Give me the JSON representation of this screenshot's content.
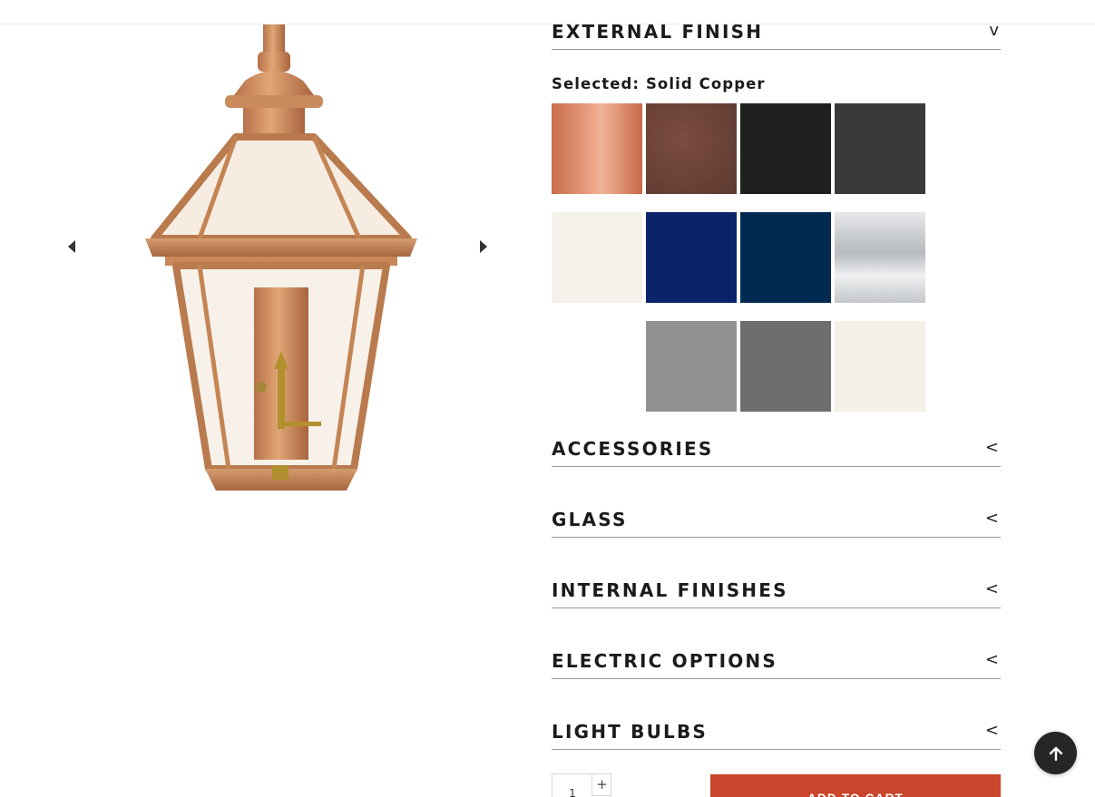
{
  "external_finish": {
    "title": "EXTERNAL FINISH",
    "toggle": "v",
    "selected_prefix": "Selected:",
    "selected_value": "Solid Copper",
    "swatches": [
      {
        "name": "swatch-solid-copper",
        "color": "#d97d58"
      },
      {
        "name": "swatch-antique-copper",
        "color": "#6a4337"
      },
      {
        "name": "swatch-black",
        "color": "#1f1f1f"
      },
      {
        "name": "swatch-charcoal",
        "color": "#3a3a3a"
      },
      {
        "name": "swatch-white",
        "color": "#f4f1ea"
      },
      {
        "name": "swatch-navy",
        "color": "#0a236a"
      },
      {
        "name": "swatch-dark-blue",
        "color": "#012a52"
      },
      {
        "name": "swatch-silver",
        "color": "#c9cbce"
      },
      {
        "name": "swatch-gray",
        "color": "#909290"
      },
      {
        "name": "swatch-dark-gray",
        "color": "#6e6e6e"
      },
      {
        "name": "swatch-cream",
        "color": "#f4f0e6"
      }
    ]
  },
  "sections": [
    {
      "title": "ACCESSORIES",
      "toggle": "<"
    },
    {
      "title": "GLASS",
      "toggle": "<"
    },
    {
      "title": "INTERNAL FINISHES",
      "toggle": "<"
    },
    {
      "title": "ELECTRIC OPTIONS",
      "toggle": "<"
    },
    {
      "title": "LIGHT BULBS",
      "toggle": "<"
    }
  ],
  "cart": {
    "quantity": "1",
    "plus": "+",
    "add_to_cart": "ADD TO CART"
  },
  "icons": {
    "prev": "caret-left-icon",
    "next": "caret-right-icon",
    "back_to_top": "arrow-up-icon"
  },
  "colors": {
    "accent": "#c9452b",
    "top_button": "#262626"
  }
}
